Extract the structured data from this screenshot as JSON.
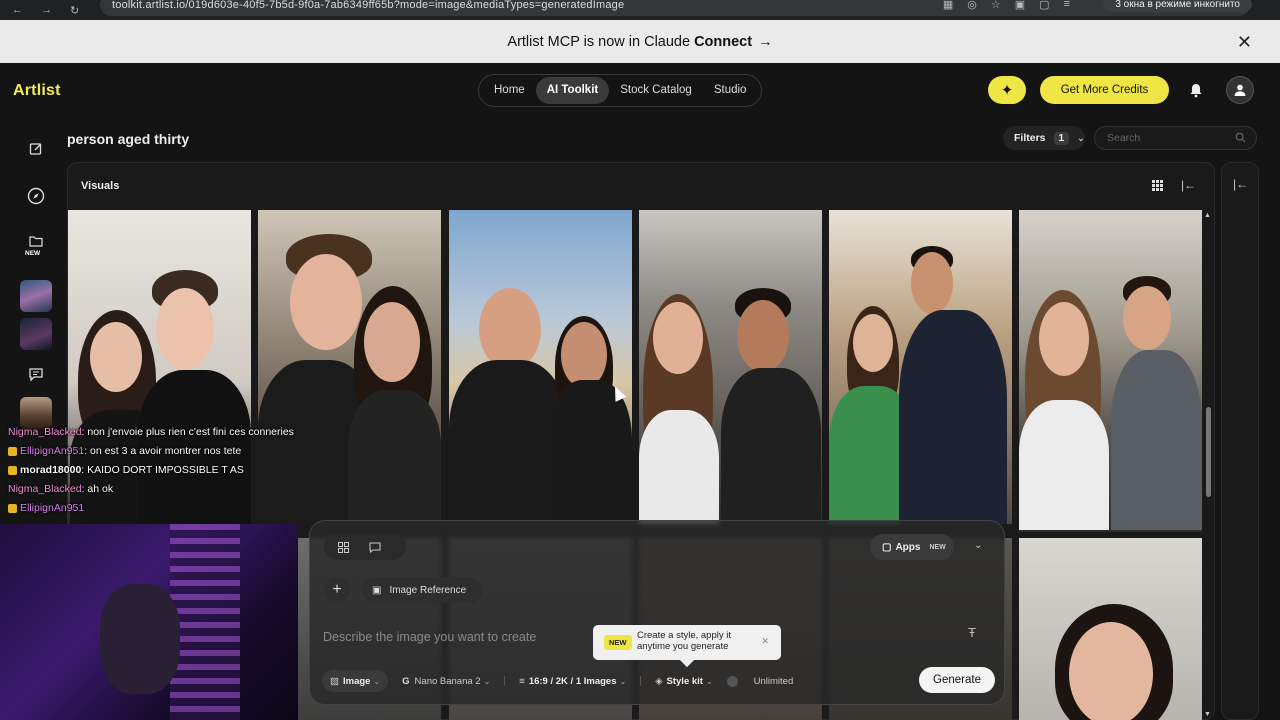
{
  "browser": {
    "url": "toolkit.artlist.io/019d603e-40f5-7b5d-9f0a-7ab6349ff65b?mode=image&mediaTypes=generatedImage",
    "incognito_label": "3 окна в режиме инкогнито"
  },
  "announcement": {
    "text": "Artlist MCP is now in Claude",
    "bold": "Connect",
    "arrow": "→",
    "close_icon": "close-icon"
  },
  "header": {
    "logo": "Artlist",
    "nav": [
      "Home",
      "AI Toolkit",
      "Stock Catalog",
      "Studio"
    ],
    "active_nav": "AI Toolkit",
    "credits_label": "Get More Credits",
    "accent": "#efe545"
  },
  "rail": {
    "new_label": "NEW"
  },
  "page": {
    "title": "person aged thirty",
    "filters_label": "Filters",
    "filters_count": "1",
    "search_placeholder": "Search",
    "visuals_label": "Visuals"
  },
  "chat": [
    {
      "user": "Nigma_Blacked",
      "text": ": non j'envoie plus rien c'est fini ces conneries"
    },
    {
      "user": "EllipignAn951",
      "text": ": on est 3 a avoir montrer nos tete"
    },
    {
      "user": "morad18000",
      "text": ": KAIDO DORT IMPOSSIBLE T AS"
    },
    {
      "user": "Nigma_Blacked",
      "text": ": ah ok"
    },
    {
      "user": "EllipignAn951",
      "text": ""
    }
  ],
  "prompt": {
    "apps_label": "Apps",
    "apps_new": "NEW",
    "image_reference": "Image Reference",
    "placeholder": "Describe the image you want to create",
    "tooltip_new": "NEW",
    "tooltip_line1": "Create a style, apply it",
    "tooltip_line2": "anytime you generate",
    "mode": "Image",
    "model": "Nano Banana 2",
    "settings": "16:9 / 2K / 1 Images",
    "style_kit": "Style kit",
    "unlimited": "Unlimited",
    "generate": "Generate"
  }
}
